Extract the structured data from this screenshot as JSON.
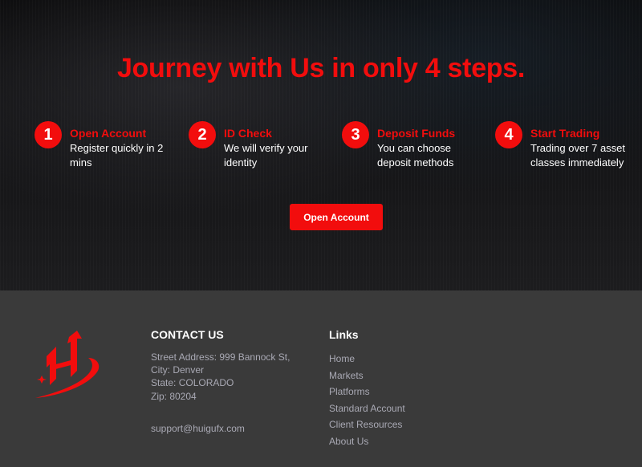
{
  "hero": {
    "title": "Journey with Us in only 4 steps.",
    "steps": [
      {
        "number": "1",
        "title": "Open Account",
        "description": "Register quickly in 2 mins"
      },
      {
        "number": "2",
        "title": "ID Check",
        "description": "We will verify your identity"
      },
      {
        "number": "3",
        "title": "Deposit Funds",
        "description": "You can choose deposit methods"
      },
      {
        "number": "4",
        "title": "Start Trading",
        "description": "Trading over 7 asset classes immediately"
      }
    ],
    "cta_label": "Open Account"
  },
  "footer": {
    "logo_icon": "brand-logo-icon",
    "contact": {
      "heading": "CONTACT US",
      "street": "Street Address: 999 Bannock St,",
      "city": "City: Denver",
      "state": "State: COLORADO",
      "zip": "Zip: 80204",
      "email": "support@huigufx.com"
    },
    "links": {
      "heading": "Links",
      "items": [
        "Home",
        "Markets",
        "Platforms",
        "Standard Account",
        "Client Resources",
        "About Us"
      ]
    }
  },
  "colors": {
    "accent": "#f20d0d",
    "footer_bg": "#3a3a3a",
    "muted_text": "#a9a9b4"
  }
}
